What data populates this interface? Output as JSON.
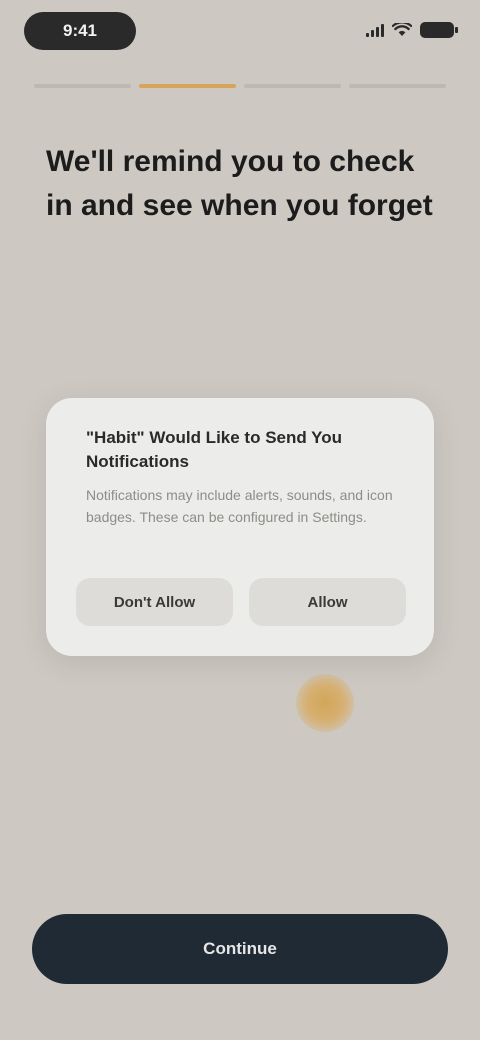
{
  "status_bar": {
    "time": "9:41",
    "icons": [
      "signal-icon",
      "wifi-icon",
      "battery-icon"
    ]
  },
  "progress": {
    "step": 2,
    "total": 4
  },
  "headline": "We'll remind you to check in and see when you forget",
  "dialog": {
    "title": "\"Habit\" Would Like to Send You Notifications",
    "body": "Notifications may include alerts, sounds, and icon badges. These can be configured in Settings.",
    "deny_label": "Don't Allow",
    "allow_label": "Allow"
  },
  "continue_label": "Continue",
  "colors": {
    "background": "#cdc9c2",
    "accent": "#d8a35a",
    "cta": "#1f2a35",
    "dialog": "#ececea"
  }
}
